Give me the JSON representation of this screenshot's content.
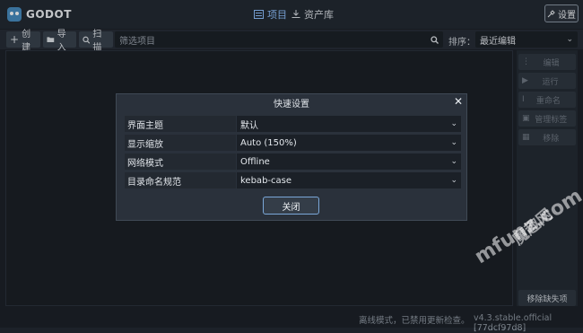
{
  "app": {
    "logo_text": "GODOT",
    "accent": "#478cbf"
  },
  "tabs": [
    {
      "label": "项目",
      "icon": "list-icon",
      "active": true
    },
    {
      "label": "资产库",
      "icon": "download-icon",
      "active": false
    }
  ],
  "settings_button": {
    "label": "设置",
    "icon": "tools-icon"
  },
  "toolbar": {
    "create_label": "创建",
    "import_label": "导入",
    "scan_label": "扫描",
    "filter_placeholder": "筛选项目",
    "sort_label": "排序：",
    "sort_value": "最近编辑"
  },
  "side_buttons": [
    {
      "label": "编辑",
      "icon": "edit-icon"
    },
    {
      "label": "运行",
      "icon": "play-icon"
    },
    {
      "label": "重命名",
      "icon": "rename-icon"
    },
    {
      "label": "管理标签",
      "icon": "tag-icon"
    },
    {
      "label": "移除",
      "icon": "trash-icon"
    }
  ],
  "side_bottom": {
    "label": "移除缺失项"
  },
  "status": {
    "left": "离线模式，已禁用更新检查。",
    "version": "v4.3.stable.official [77dcf97d8]"
  },
  "dialog": {
    "title": "快速设置",
    "rows": [
      {
        "label": "界面主题",
        "value": "默认"
      },
      {
        "label": "显示缩放",
        "value": "Auto (150%)"
      },
      {
        "label": "网络模式",
        "value": "Offline"
      },
      {
        "label": "目录命名规范",
        "value": "kebab-case"
      }
    ],
    "close_label": "关闭"
  },
  "watermark": {
    "line1": "魔趣网",
    "line2": "mfunz.com"
  }
}
